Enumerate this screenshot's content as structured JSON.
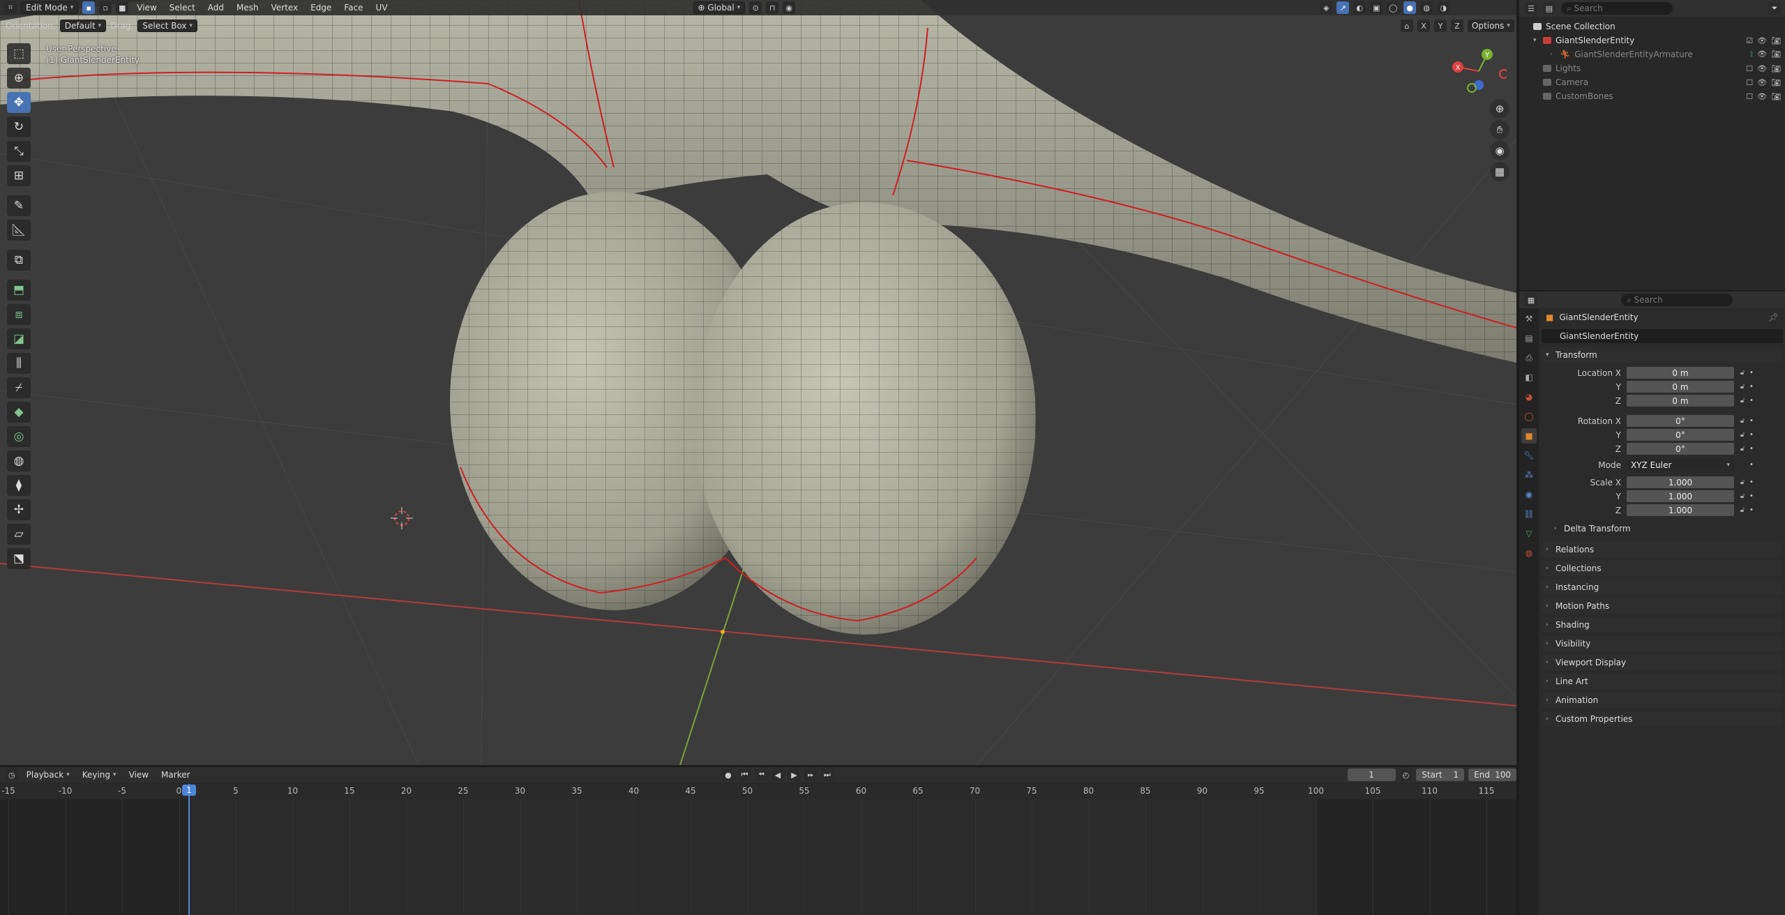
{
  "header": {
    "mode": "Edit Mode",
    "menus": [
      "View",
      "Select",
      "Add",
      "Mesh",
      "Vertex",
      "Edge",
      "Face",
      "UV"
    ],
    "transform_orientation": "Global",
    "orientation_label": "Orientation:",
    "orientation_value": "Default",
    "drag_label": "Drag:",
    "drag_value": "Select Box",
    "axes": [
      "X",
      "Y",
      "Z"
    ],
    "options_label": "Options"
  },
  "viewport": {
    "perspective_label": "User Perspective",
    "object_label": "(1) GiantSlenderEntity",
    "gizmo_axes": {
      "x": "X",
      "y": "Y"
    }
  },
  "toolbar": {
    "tools": [
      "select-box",
      "cursor",
      "move",
      "rotate",
      "scale",
      "transform",
      "annotate",
      "measure",
      "add-cube",
      "extrude",
      "inset",
      "bevel",
      "loop-cut",
      "knife",
      "poly-build",
      "spin",
      "smooth",
      "edge-slide",
      "shrink-fatten",
      "shear",
      "rip"
    ]
  },
  "timeline": {
    "menus": [
      "Playback",
      "Keying",
      "View",
      "Marker"
    ],
    "current_frame": "1",
    "start_label": "Start",
    "start_value": "1",
    "end_label": "End",
    "end_value": "100",
    "ticks": [
      "-15",
      "-10",
      "-5",
      "0",
      "5",
      "10",
      "15",
      "20",
      "25",
      "30",
      "35",
      "40",
      "45",
      "50",
      "55",
      "60",
      "65",
      "70",
      "75",
      "80",
      "85",
      "90",
      "95",
      "100",
      "105",
      "110",
      "115"
    ],
    "playhead_label": "1"
  },
  "outliner": {
    "search_placeholder": "Search",
    "rows": [
      {
        "label": "Scene Collection",
        "color": "#dddddd"
      },
      {
        "label": "GiantSlenderEntity",
        "color": "#dd4444"
      },
      {
        "label": "GiantSlenderEntityArmature",
        "color": "#888888"
      },
      {
        "label": "Lights",
        "color": "#888888"
      },
      {
        "label": "Camera",
        "color": "#888888"
      },
      {
        "label": "CustomBones",
        "color": "#888888"
      }
    ]
  },
  "properties": {
    "search_placeholder": "Search",
    "object_name": "GiantSlenderEntity",
    "object_field": "GiantSlenderEntity",
    "transform_header": "Transform",
    "location_label": "Location X",
    "location": [
      "0 m",
      "0 m",
      "0 m"
    ],
    "rotation_label": "Rotation X",
    "rotation": [
      "0°",
      "0°",
      "0°"
    ],
    "mode_label": "Mode",
    "mode_value": "XYZ Euler",
    "scale_label": "Scale X",
    "scale": [
      "1.000",
      "1.000",
      "1.000"
    ],
    "axis_y": "Y",
    "axis_z": "Z",
    "delta_transform": "Delta Transform",
    "panels": [
      "Relations",
      "Collections",
      "Instancing",
      "Motion Paths",
      "Shading",
      "Visibility",
      "Viewport Display",
      "Line Art",
      "Animation",
      "Custom Properties"
    ]
  }
}
